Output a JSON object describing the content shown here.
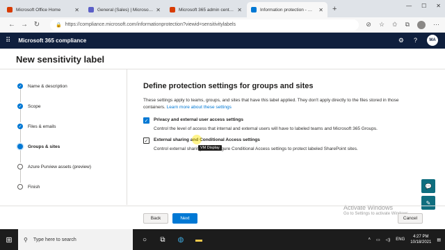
{
  "browser": {
    "tabs": [
      {
        "label": "Microsoft Office Home",
        "color": "#d83b01"
      },
      {
        "label": "General (Sales) | Microsoft Teams",
        "color": "#5b5fc7"
      },
      {
        "label": "Microsoft 365 admin center - Gr...",
        "color": "#d83b01"
      },
      {
        "label": "Information protection - Microso...",
        "color": "#0078d4"
      }
    ],
    "url": "https://compliance.microsoft.com/informationprotection?viewid=sensitivitylabels"
  },
  "appbar": {
    "title": "Microsoft 365 compliance",
    "avatar_initials": "MA"
  },
  "panel": {
    "title": "New sensitivity label"
  },
  "steps": [
    {
      "label": "Name & description",
      "state": "done"
    },
    {
      "label": "Scope",
      "state": "done"
    },
    {
      "label": "Files & emails",
      "state": "done"
    },
    {
      "label": "Groups & sites",
      "state": "current"
    },
    {
      "label": "Azure Purview assets (preview)",
      "state": "todo"
    },
    {
      "label": "Finish",
      "state": "todo"
    }
  ],
  "content": {
    "heading": "Define protection settings for groups and sites",
    "description": "These settings apply to teams, groups, and sites that have this label applied. They don't apply directly to the files stored in those containers.",
    "learn_more": "Learn more about these settings",
    "option1": {
      "label": "Privacy and external user access settings",
      "sub": "Control the level of access that internal and external users will have to labeled teams and Microsoft 365 Groups.",
      "checked": true
    },
    "option2": {
      "label": "External sharing and Conditional Access settings",
      "sub": "Control external sharing and configure Conditional Access settings to protect labeled SharePoint sites.",
      "checked": true
    },
    "tooltip": "VM Display"
  },
  "footer": {
    "back": "Back",
    "next": "Next",
    "cancel": "Cancel"
  },
  "watermark": {
    "line1": "Activate Windows",
    "line2": "Go to Settings to activate Windows."
  },
  "taskbar": {
    "search_placeholder": "Type here to search",
    "lang": "ENG",
    "time": "4:27 PM",
    "date": "10/18/2021"
  }
}
